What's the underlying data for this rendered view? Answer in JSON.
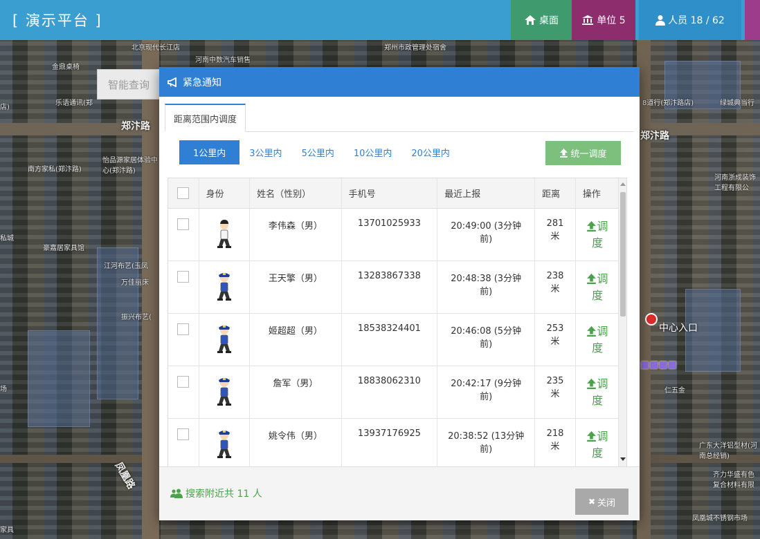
{
  "header": {
    "title": "[ 演示平台 ]",
    "nav": {
      "desktop": "桌面",
      "unit": "单位 5",
      "person": "人员 18 / 62"
    }
  },
  "map": {
    "smart_search": "智能查询",
    "labels": [
      "北京现代长江店",
      "河南中数汽车销售",
      "郑州市政管理处宿舍",
      "金鼎桌椅",
      "乐语通讯(郑",
      "南方家私(郑汴路)",
      "怡品源家居体验中心(郑汴路)",
      "豪嘉居家具馆",
      "江河布艺(玉凤",
      "万佳丽床",
      "振兴布艺(",
      "8道行(郑汴路店)",
      "绿城典当行",
      "河南浙成装饰工程有限公",
      "广东大洋铝型材(河南总经销)",
      "齐力华盛有色复合材料有限",
      "凤凰城不锈钢市场",
      "家具",
      "私城",
      "场",
      "店)",
      "仁五金"
    ],
    "roads": [
      "郑汴路",
      "郑汴路",
      "凤凰路"
    ],
    "entrance": "中心入口"
  },
  "modal": {
    "title": "紧急通知",
    "tab": "距离范围内调度",
    "ranges": [
      "1公里内",
      "3公里内",
      "5公里内",
      "10公里内",
      "20公里内"
    ],
    "active_range": "1公里内",
    "dispatch_all": "统一调度",
    "columns": [
      "身份",
      "姓名（性别）",
      "手机号",
      "最近上报",
      "距离",
      "操作"
    ],
    "rows": [
      {
        "name": "李伟森（男）",
        "phone": "13701025933",
        "time": "20:49:00 (3分钟前)",
        "distance": "281米",
        "action": "调度",
        "role": "civilian"
      },
      {
        "name": "王天擎（男）",
        "phone": "13283867338",
        "time": "20:48:38 (3分钟前)",
        "distance": "238米",
        "action": "调度",
        "role": "police"
      },
      {
        "name": "姬超超（男）",
        "phone": "18538324401",
        "time": "20:46:08 (5分钟前)",
        "distance": "253米",
        "action": "调度",
        "role": "police"
      },
      {
        "name": "詹军（男）",
        "phone": "18838062310",
        "time": "20:42:17 (9分钟前)",
        "distance": "235米",
        "action": "调度",
        "role": "police"
      },
      {
        "name": "姚令伟（男）",
        "phone": "13937176925",
        "time": "20:38:52 (13分钟前)",
        "distance": "218米",
        "action": "调度",
        "role": "police"
      }
    ],
    "footer_count": "搜索附近共 11 人",
    "close": "关闭"
  },
  "colors": {
    "header": "#3a9fd0",
    "modal_head": "#2f7fd4",
    "green": "#4aa34a",
    "desk": "#3f9a6e",
    "unit": "#8d2d6e"
  },
  "icons": {
    "desktop": "home-icon",
    "unit": "bank-icon",
    "person": "user-icon",
    "notify": "bullhorn-icon",
    "dispatch": "upload-icon",
    "group": "users-icon",
    "close": "close-icon"
  }
}
